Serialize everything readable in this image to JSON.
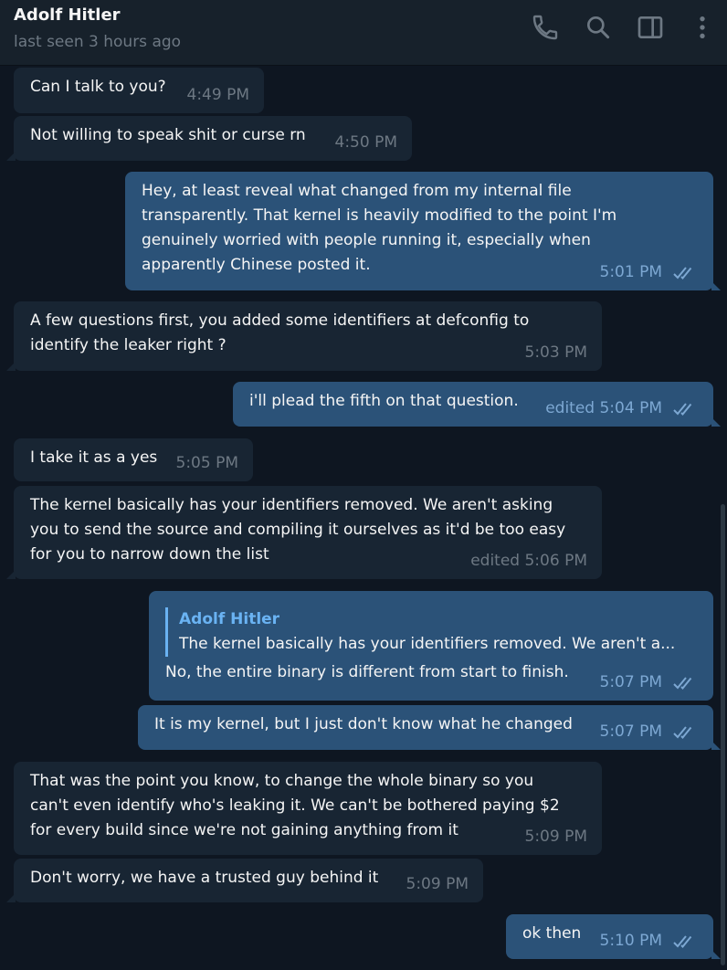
{
  "header": {
    "contact_name": "Adolf Hitler",
    "status": "last seen 3 hours ago",
    "icons": [
      "phone-icon",
      "search-icon",
      "sidebar-toggle-icon",
      "more-vertical-icon"
    ]
  },
  "colors": {
    "background": "#0e1621",
    "header": "#17212b",
    "incoming_bubble": "#182533",
    "outgoing_bubble": "#2b5278",
    "accent": "#6ab3f3"
  },
  "messages": [
    {
      "direction": "in",
      "text": "Can I talk to you?",
      "time": "4:49 PM"
    },
    {
      "direction": "in",
      "text": "Not willing to speak shit or curse rn",
      "time": "4:50 PM"
    },
    {
      "direction": "out",
      "text": "Hey, at least reveal what changed from my internal file\ntransparently. That kernel is heavily modified to the point I'm\ngenuinely worried with people running it, especially when\napparently Chinese posted it.",
      "time": "5:01 PM",
      "read": true
    },
    {
      "direction": "in",
      "text": "A few questions first, you added some identifiers at defconfig to\nidentify the leaker right ?",
      "time": "5:03 PM"
    },
    {
      "direction": "out",
      "text": "i'll plead the fifth on that question.",
      "time": "edited 5:04 PM",
      "read": true
    },
    {
      "direction": "in",
      "text": "I take it as a yes",
      "time": "5:05 PM"
    },
    {
      "direction": "in",
      "text": "The kernel basically has your identifiers removed. We aren't asking\nyou to send the source and compiling it ourselves as it'd be too easy\nfor you to narrow down the list",
      "time": "edited 5:06 PM"
    },
    {
      "direction": "out",
      "reply_to": {
        "name": "Adolf Hitler",
        "text": "The kernel basically has your identifiers removed. We aren't a..."
      },
      "text": "No, the entire binary is different from start to finish.",
      "time": "5:07 PM",
      "read": true
    },
    {
      "direction": "out",
      "text": "It is my kernel, but I just don't know what he changed",
      "time": "5:07 PM",
      "read": true
    },
    {
      "direction": "in",
      "text": "That was the point you know, to change the whole binary so you\ncan't even identify who's leaking it. We can't be bothered paying $2\nfor every build since we're not gaining anything from it",
      "time": "5:09 PM"
    },
    {
      "direction": "in",
      "text": "Don't worry, we have a trusted guy behind it",
      "time": "5:09 PM"
    },
    {
      "direction": "out",
      "text": "ok then",
      "time": "5:10 PM",
      "read": true
    }
  ]
}
